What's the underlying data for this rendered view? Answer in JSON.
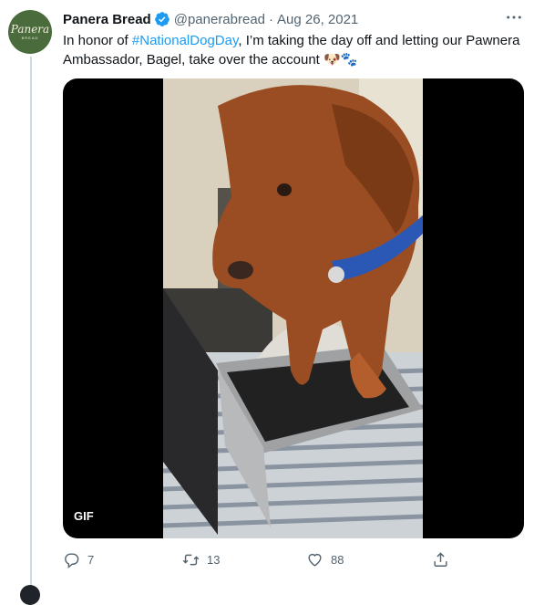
{
  "tweet": {
    "author_name": "Panera Bread",
    "handle": "@panerabread",
    "separator": "·",
    "date": "Aug 26, 2021",
    "text_before": "In honor of ",
    "hashtag": "#NationalDogDay",
    "text_after": ", I’m taking the day off and letting our Pawnera Ambassador, Bagel, take over the account ",
    "emoji": "🐶🐾"
  },
  "avatar": {
    "logo_text": "Panera",
    "logo_subtext": "BREAD"
  },
  "media": {
    "badge": "GIF"
  },
  "actions": {
    "reply_count": "7",
    "retweet_count": "13",
    "like_count": "88"
  },
  "colors": {
    "accent": "#1d9bf0",
    "secondary_text": "#536471",
    "avatar_bg": "#4a6b3c"
  }
}
